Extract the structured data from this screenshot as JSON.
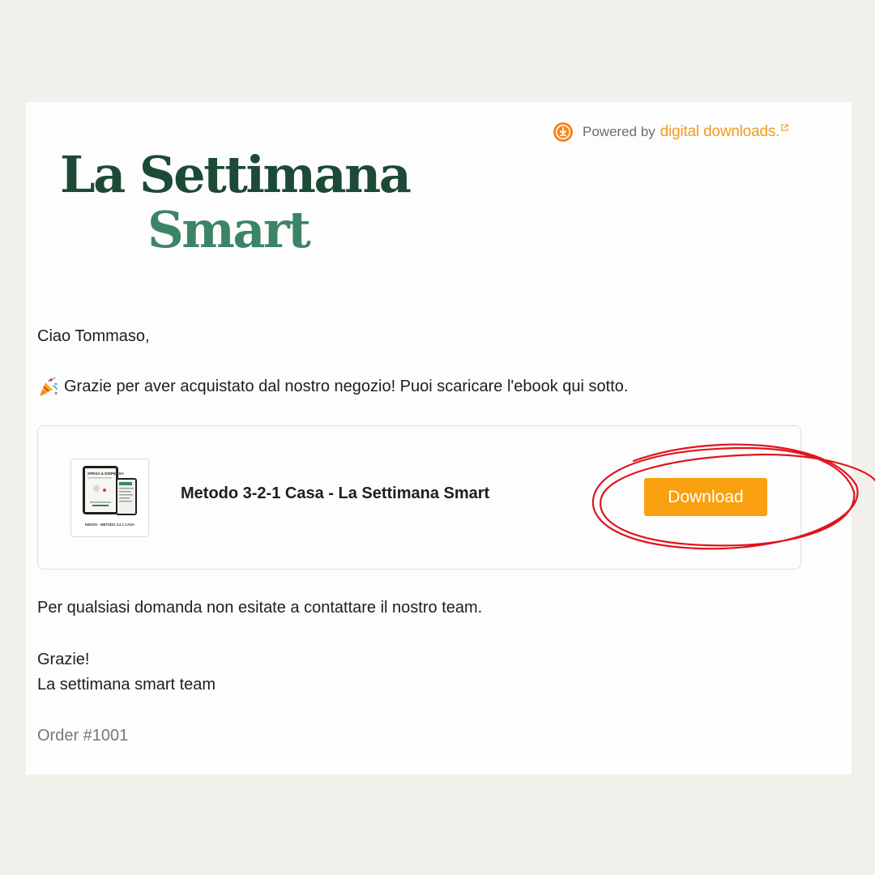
{
  "powered": {
    "prefix": "Powered by",
    "brand": "digital downloads.",
    "icon": "download-circle-icon",
    "brand_color": "#f59a1c"
  },
  "logo": {
    "line1": "La Settimana",
    "line2": "Smart",
    "color_dark": "#1c4a36",
    "color_light": "#3b8566"
  },
  "email": {
    "greeting": "Ciao Tommaso,",
    "thanks_emoji": "party-popper-icon",
    "thanks": "Grazie per aver acquistato dal nostro negozio! Puoi scaricare l'ebook qui sotto.",
    "contact": "Per qualsiasi domanda non esitate a contattare il nostro team.",
    "signoff": "Grazie!",
    "team": "La settimana smart team",
    "order": "Order #1001"
  },
  "product": {
    "title": "Metodo 3-2-1 Casa - La Settimana Smart",
    "thumb_text": "EBOOK - METODO 3.2.1 CASA",
    "thumb_heading": "SPESA & DISPENSA",
    "download_label": "Download",
    "download_color": "#f8a00f",
    "annotation_color": "#e0141e"
  }
}
